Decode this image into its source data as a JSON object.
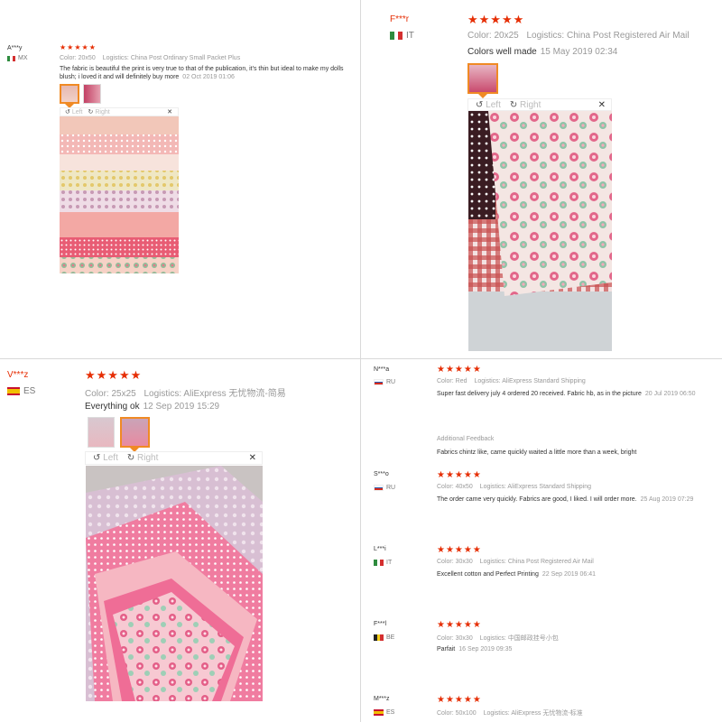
{
  "labels": {
    "color": "Color:",
    "logistics": "Logistics:",
    "left": "Left",
    "right": "Right",
    "additional": "Additional Feedback"
  },
  "stars": "★★★★★",
  "reviews": [
    {
      "user": "A***y",
      "country": "MX",
      "color": "20x50",
      "logistics": "China Post Ordinary Small Packet Plus",
      "text": "The fabric is beautiful the print is very true to that of the publication, it's thin but ideal to make my dolls blush; i loved it and will definitely buy more",
      "date": "02 Oct 2019 01:06"
    },
    {
      "user": "F***r",
      "country": "IT",
      "color": "20x25",
      "logistics": "China Post Registered Air Mail",
      "text": "Colors well made",
      "date": "15 May 2019 02:34"
    },
    {
      "user": "V***z",
      "country": "ES",
      "color": "25x25",
      "logistics": "AliExpress 无忧物流-简易",
      "text": "Everything ok",
      "date": "12 Sep 2019 15:29"
    },
    {
      "user": "N***a",
      "country": "RU",
      "color": "Red",
      "logistics": "AliExpress Standard Shipping",
      "text": "Super fast delivery july 4 ordered 20 received. Fabric hb, as in the picture",
      "date": "20 Jul 2019 06:50",
      "additional": "Fabrics chintz like, came quickly waited a little more than a week, bright"
    },
    {
      "user": "S***o",
      "country": "RU",
      "color": "40x50",
      "logistics": "AliExpress Standard Shipping",
      "text": "The order came very quickly. Fabrics are good, I liked. I will order more.",
      "date": "25 Aug 2019 07:29"
    },
    {
      "user": "L***i",
      "country": "IT",
      "color": "30x30",
      "logistics": "China Post Registered Air Mail",
      "text": "Excellent cotton and Perfect Printing",
      "date": "22 Sep 2019 06:41"
    },
    {
      "user": "F***l",
      "country": "BE",
      "color": "30x30",
      "logistics": "中国邮政挂号小包",
      "text": "Parfait",
      "date": "16 Sep 2019 09:35"
    },
    {
      "user": "M***z",
      "country": "ES",
      "color": "50x100",
      "logistics": "AliExpress 无忧物流-标准"
    }
  ]
}
